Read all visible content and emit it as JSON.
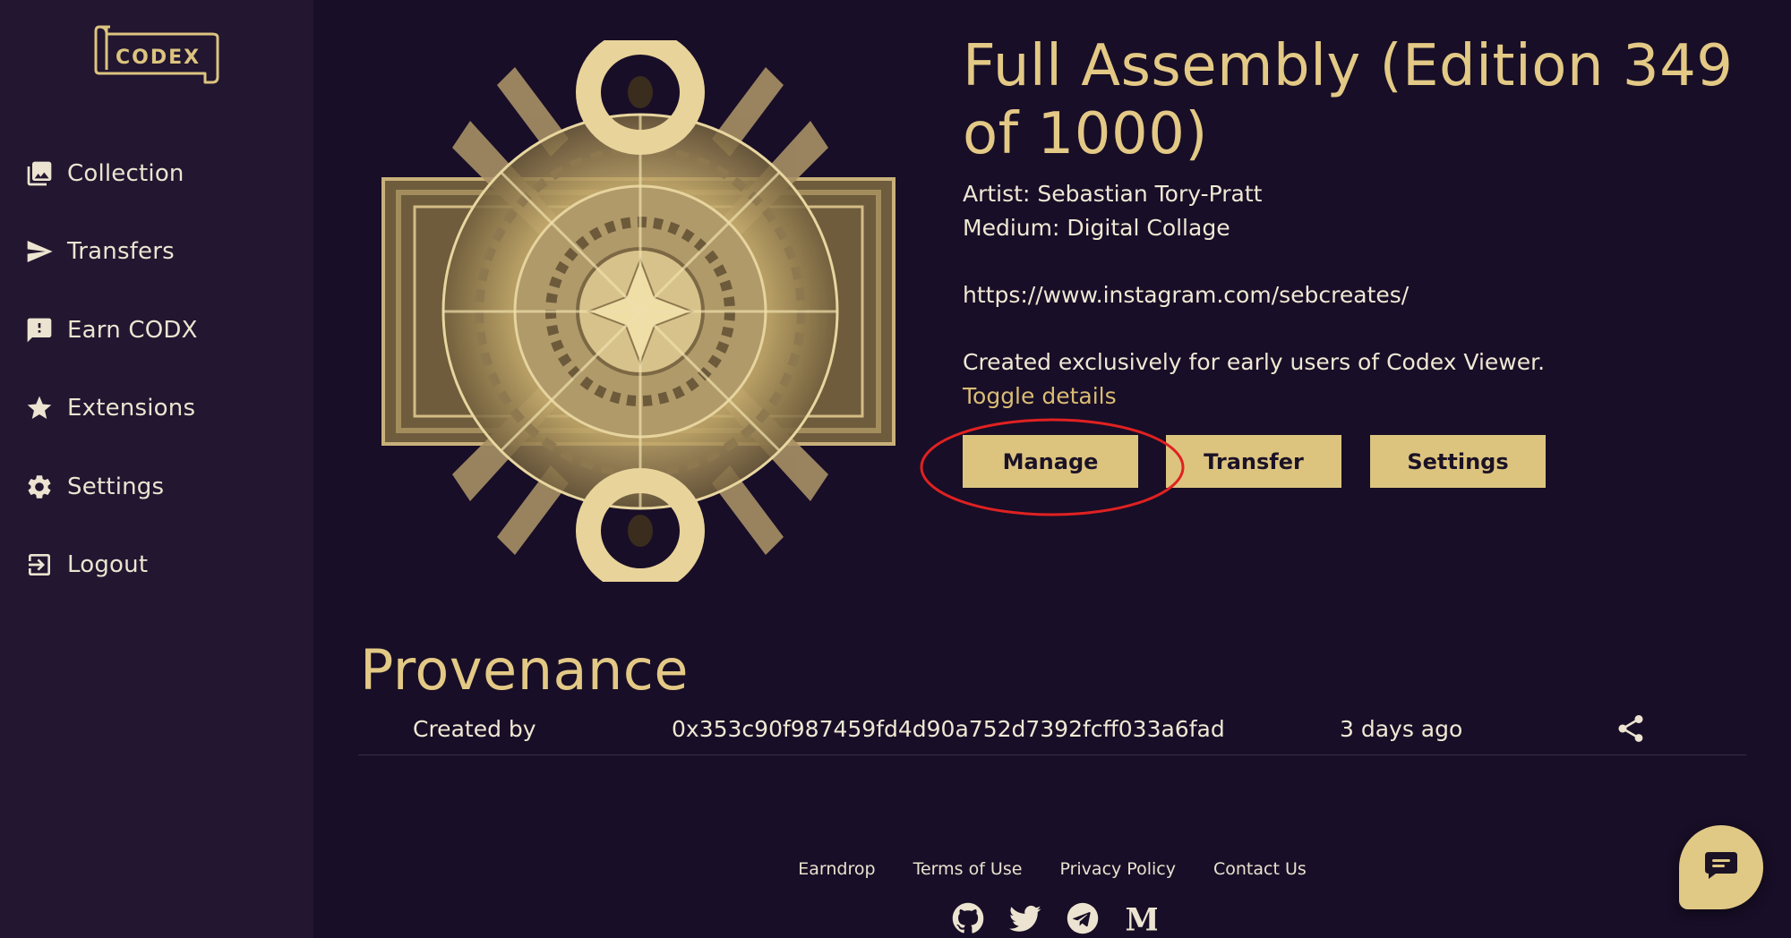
{
  "app": {
    "logo_text": "CODEX",
    "accent_color": "#dcc47f",
    "background_color": "#180e27",
    "sidebar_color": "#221631"
  },
  "sidebar": {
    "items": [
      {
        "label": "Collection",
        "icon": "gallery-icon"
      },
      {
        "label": "Transfers",
        "icon": "send-icon"
      },
      {
        "label": "Earn CODX",
        "icon": "feedback-icon"
      },
      {
        "label": "Extensions",
        "icon": "star-icon"
      },
      {
        "label": "Settings",
        "icon": "gear-icon"
      },
      {
        "label": "Logout",
        "icon": "logout-icon"
      }
    ]
  },
  "artwork": {
    "title": "Full Assembly (Edition 349 of 1000)",
    "artist_line": "Artist: Sebastian Tory-Pratt",
    "medium_line": "Medium: Digital Collage",
    "link": "https://www.instagram.com/sebcreates/",
    "description": "Created exclusively for early users of Codex Viewer.",
    "toggle_label": "Toggle details"
  },
  "actions": {
    "manage_label": "Manage",
    "transfer_label": "Transfer",
    "settings_label": "Settings"
  },
  "provenance": {
    "title": "Provenance",
    "rows": [
      {
        "event": "Created by",
        "address": "0x353c90f987459fd4d90a752d7392fcff033a6fad",
        "time": "3 days ago"
      }
    ]
  },
  "footer": {
    "links": [
      "Earndrop",
      "Terms of Use",
      "Privacy Policy",
      "Contact Us"
    ],
    "socials": [
      "github-icon",
      "twitter-icon",
      "telegram-icon",
      "medium-icon"
    ]
  }
}
